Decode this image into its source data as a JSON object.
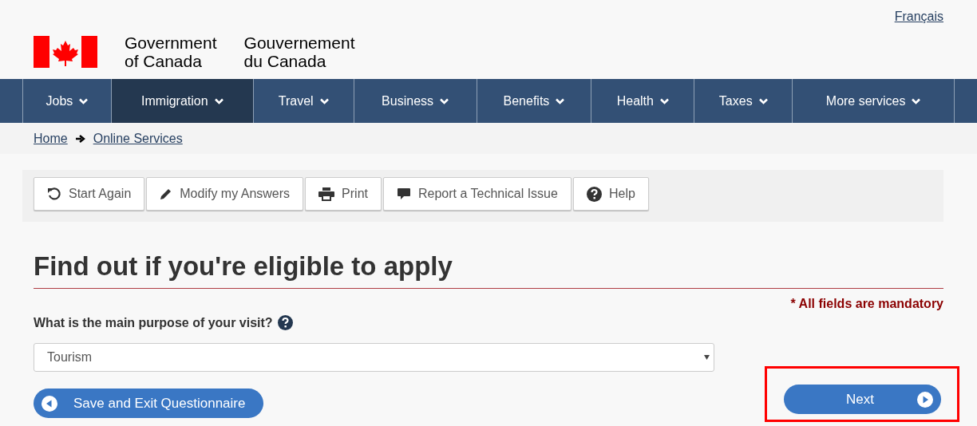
{
  "language_link": "Français",
  "signature": {
    "english": [
      "Government",
      "of Canada"
    ],
    "french": [
      "Gouvernement",
      "du Canada"
    ]
  },
  "nav": [
    {
      "label": "Jobs",
      "selected": false
    },
    {
      "label": "Immigration",
      "selected": true
    },
    {
      "label": "Travel",
      "selected": false
    },
    {
      "label": "Business",
      "selected": false
    },
    {
      "label": "Benefits",
      "selected": false
    },
    {
      "label": "Health",
      "selected": false
    },
    {
      "label": "Taxes",
      "selected": false
    },
    {
      "label": "More services",
      "selected": false
    }
  ],
  "breadcrumb": [
    "Home",
    "Online Services"
  ],
  "toolbar": [
    {
      "label": "Start Again",
      "kind": "undo"
    },
    {
      "label": "Modify my Answers",
      "kind": "pencil"
    },
    {
      "label": "Print",
      "kind": "print"
    },
    {
      "label": "Report a Technical Issue",
      "kind": "comment"
    },
    {
      "label": "Help",
      "kind": "help"
    }
  ],
  "title": "Find out if you're eligible to apply",
  "mandatory_note": "* All fields are mandatory",
  "question": {
    "label": "What is the main purpose of your visit?",
    "value": "Tourism"
  },
  "back_button": {
    "label": "Save and Exit Questionnaire"
  },
  "next_button": {
    "label": "Next",
    "highlighted": true
  }
}
